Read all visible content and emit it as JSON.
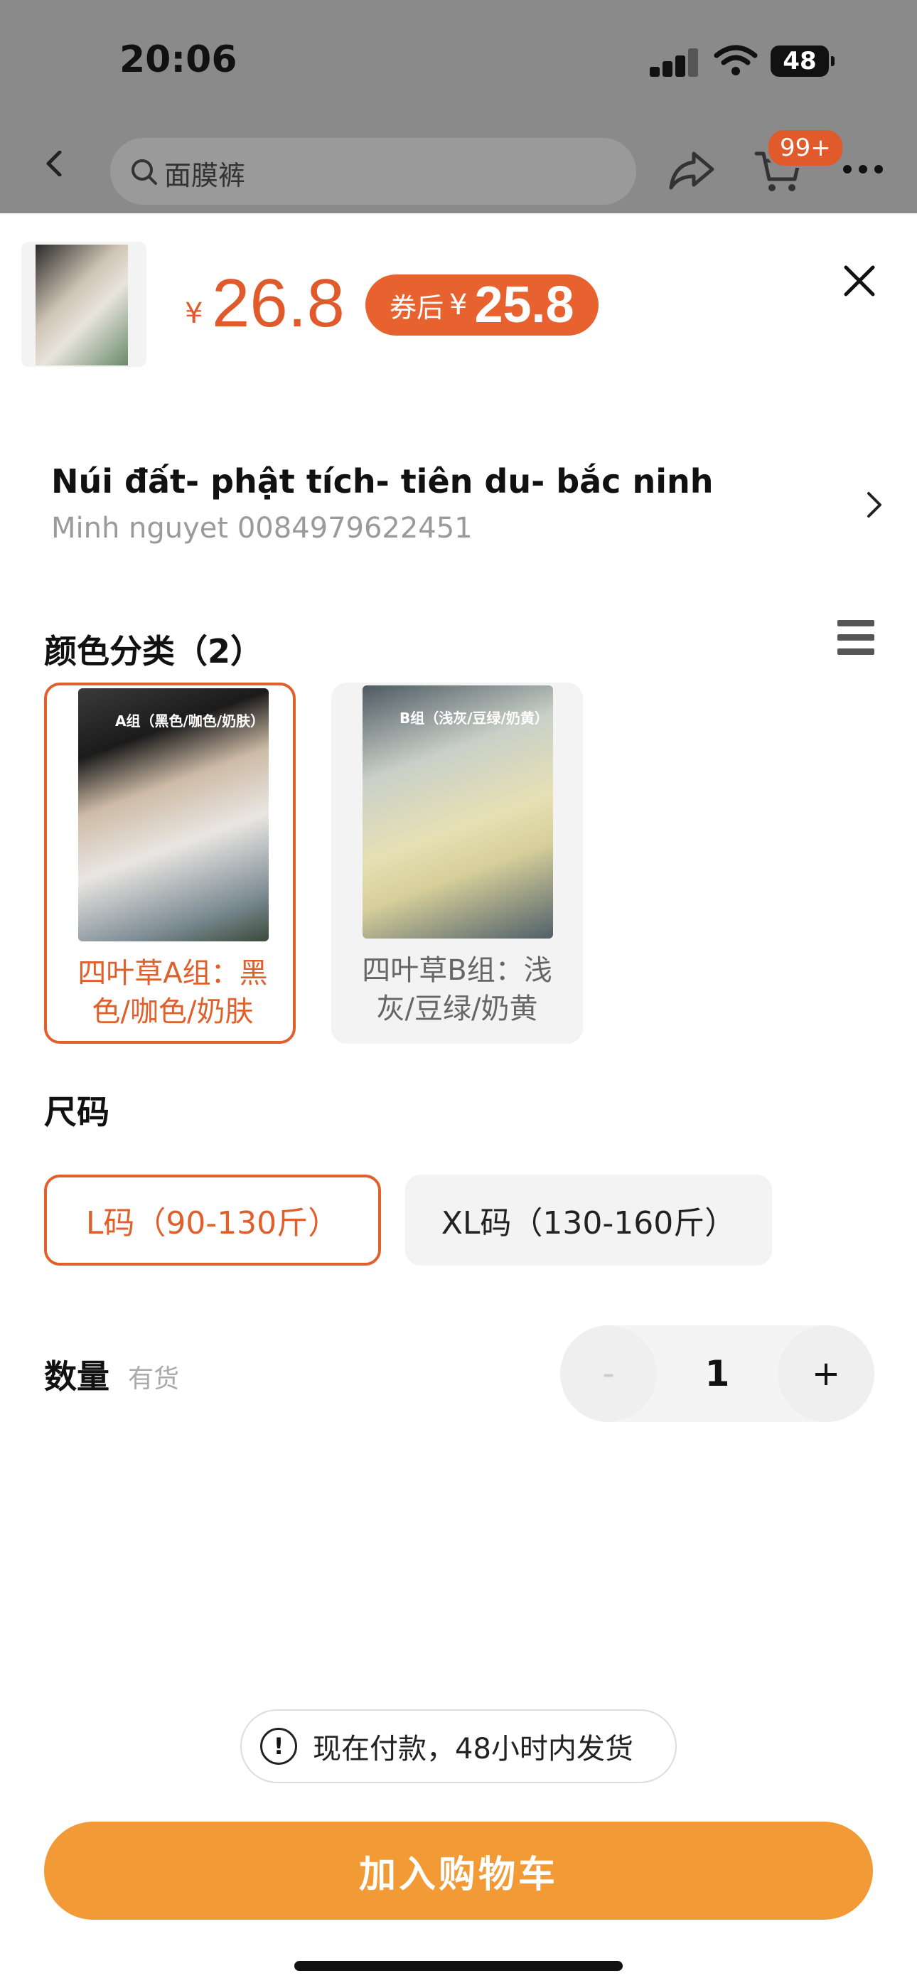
{
  "status": {
    "time": "20:06",
    "battery": "48"
  },
  "header": {
    "search_placeholder": "面膜裤",
    "cart_badge": "99+"
  },
  "product": {
    "price_symbol": "¥",
    "price": "26.8",
    "coupon_label": "券后",
    "coupon_symbol": "¥",
    "coupon_price": "25.8"
  },
  "address": {
    "title": "Núi đất- phật tích- tiên du- bắc ninh",
    "subtitle": "Minh nguyet 0084979622451"
  },
  "color_section": {
    "label": "颜色分类（2）",
    "options": [
      {
        "caption": "A组（黑色/咖色/奶肤）",
        "text": "四叶草A组：黑色/咖色/奶肤",
        "selected": true
      },
      {
        "caption": "B组（浅灰/豆绿/奶黄）",
        "text": "四叶草B组：浅灰/豆绿/奶黄",
        "selected": false
      }
    ]
  },
  "size_section": {
    "label": "尺码",
    "options": [
      {
        "text": "L码（90-130斤）",
        "selected": true
      },
      {
        "text": "XL码（130-160斤）",
        "selected": false
      }
    ]
  },
  "quantity": {
    "label": "数量",
    "stock": "有货",
    "minus": "-",
    "value": "1",
    "plus": "+"
  },
  "notice": {
    "icon": "!",
    "text": "现在付款，48小时内发货"
  },
  "cta": {
    "label": "加入购物车"
  },
  "colors": {
    "accent": "#e0602c",
    "cta": "#f29a36",
    "overlay": "#8a8a8a"
  }
}
